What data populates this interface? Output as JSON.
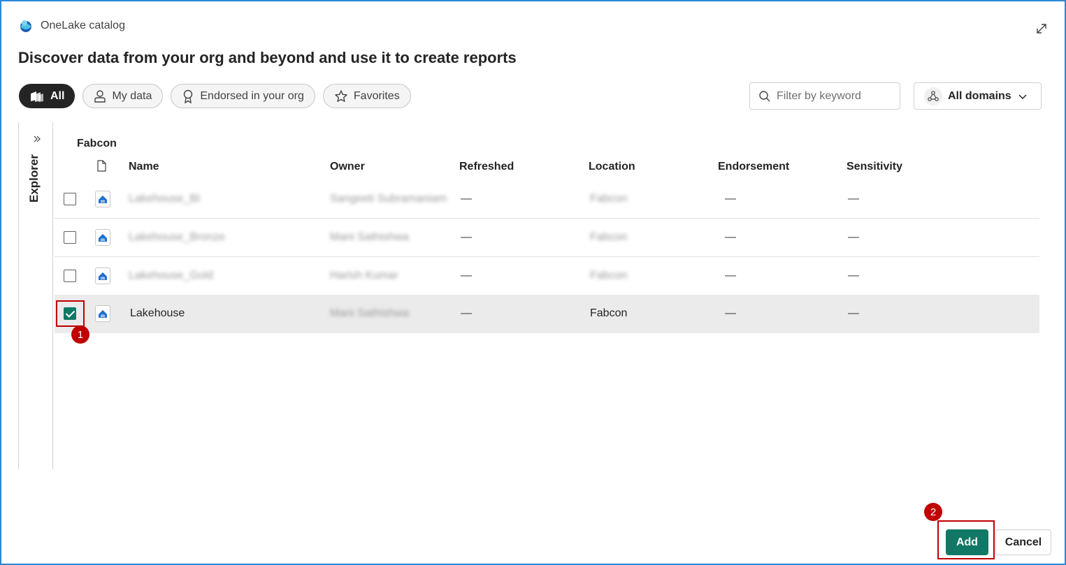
{
  "app": {
    "title": "OneLake catalog"
  },
  "page": {
    "title": "Discover data from your org and beyond and use it to create reports"
  },
  "filters": {
    "pills": [
      {
        "label": "All",
        "icon": "all-items-icon",
        "active": true
      },
      {
        "label": "My data",
        "icon": "person-icon",
        "active": false
      },
      {
        "label": "Endorsed in your org",
        "icon": "ribbon-icon",
        "active": false
      },
      {
        "label": "Favorites",
        "icon": "star-icon",
        "active": false
      }
    ],
    "search_placeholder": "Filter by keyword",
    "domains_label": "All domains"
  },
  "explorer": {
    "label": "Explorer"
  },
  "table": {
    "breadcrumb": "Fabcon",
    "columns": [
      "Name",
      "Owner",
      "Refreshed",
      "Location",
      "Endorsement",
      "Sensitivity"
    ],
    "rows": [
      {
        "checked": false,
        "name": "Lakehouse_BI",
        "owner": "Sangeeti Subramaniam",
        "refreshed": "—",
        "location": "Fabcon",
        "endorsement": "—",
        "sensitivity": "—",
        "obscured": true
      },
      {
        "checked": false,
        "name": "Lakehouse_Bronze",
        "owner": "Mani Sathishwa",
        "refreshed": "—",
        "location": "Fabcon",
        "endorsement": "—",
        "sensitivity": "—",
        "obscured": true
      },
      {
        "checked": false,
        "name": "Lakehouse_Gold",
        "owner": "Harish Kumar",
        "refreshed": "—",
        "location": "Fabcon",
        "endorsement": "—",
        "sensitivity": "—",
        "obscured": true
      },
      {
        "checked": true,
        "name": "Lakehouse",
        "owner": "Mani Sathishwa",
        "refreshed": "—",
        "location": "Fabcon",
        "endorsement": "—",
        "sensitivity": "—",
        "obscured": false
      }
    ]
  },
  "annotations": {
    "step1": "1",
    "step2": "2"
  },
  "footer": {
    "add_label": "Add",
    "cancel_label": "Cancel"
  },
  "colors": {
    "accent": "#117865",
    "highlight": "#c00000",
    "frame": "#2b88d8"
  }
}
